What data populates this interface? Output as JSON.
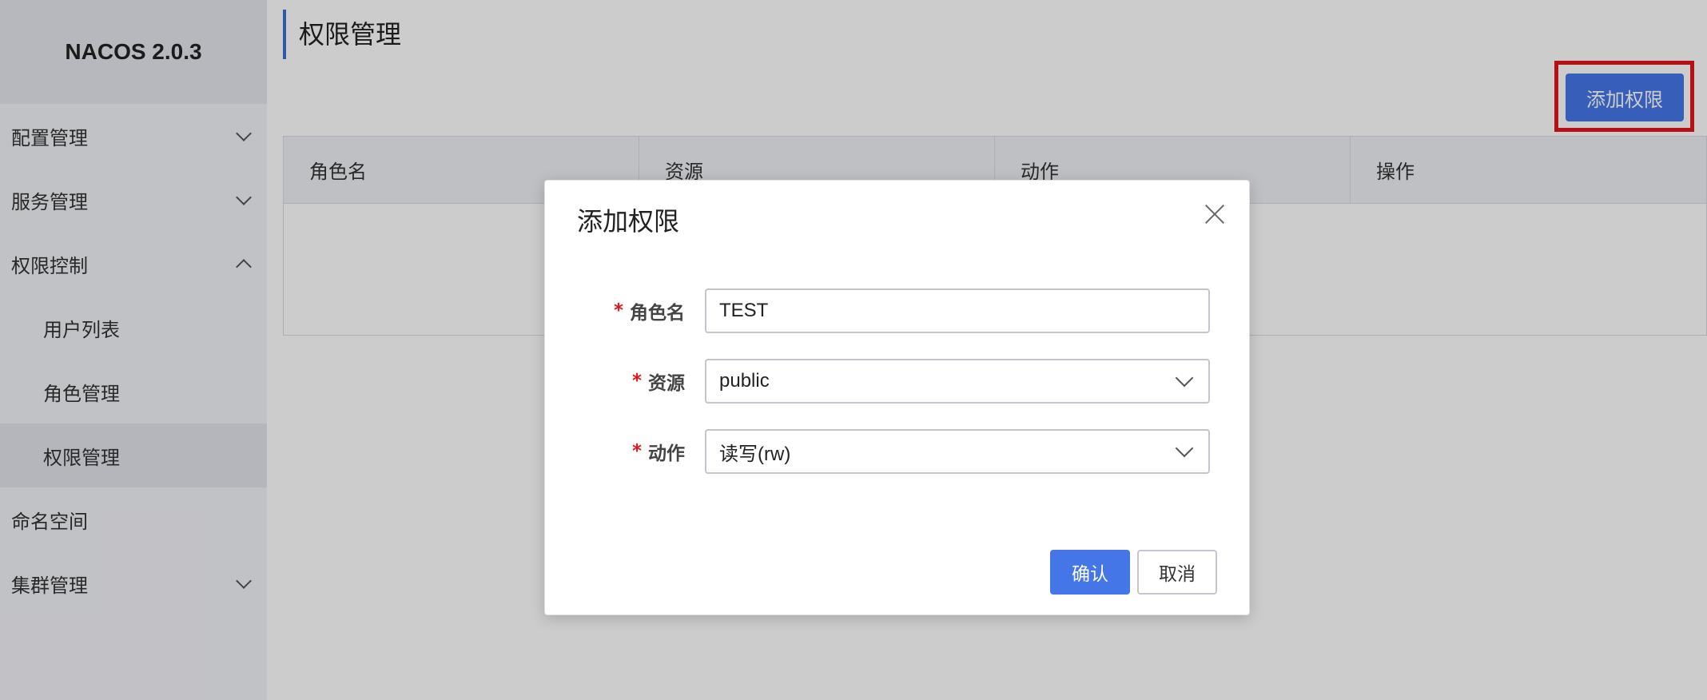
{
  "app": {
    "brand": "NACOS 2.0.3"
  },
  "sidebar": {
    "items": [
      {
        "label": "配置管理"
      },
      {
        "label": "服务管理"
      },
      {
        "label": "权限控制"
      },
      {
        "label": "用户列表"
      },
      {
        "label": "角色管理"
      },
      {
        "label": "权限管理"
      },
      {
        "label": "命名空间"
      },
      {
        "label": "集群管理"
      }
    ]
  },
  "main": {
    "page_title": "权限管理",
    "add_button": "添加权限",
    "table": {
      "headers": [
        "角色名",
        "资源",
        "动作",
        "操作"
      ]
    }
  },
  "dialog": {
    "title": "添加权限",
    "fields": {
      "role": {
        "label": "角色名",
        "value": "TEST"
      },
      "resource": {
        "label": "资源",
        "value": "public"
      },
      "action": {
        "label": "动作",
        "value": "读写(rw)"
      }
    },
    "required_mark": "*",
    "confirm": "确认",
    "cancel": "取消"
  },
  "colors": {
    "primary": "#4576e8",
    "highlight": "#e4141b",
    "accent_bar": "#3c6fd1"
  }
}
